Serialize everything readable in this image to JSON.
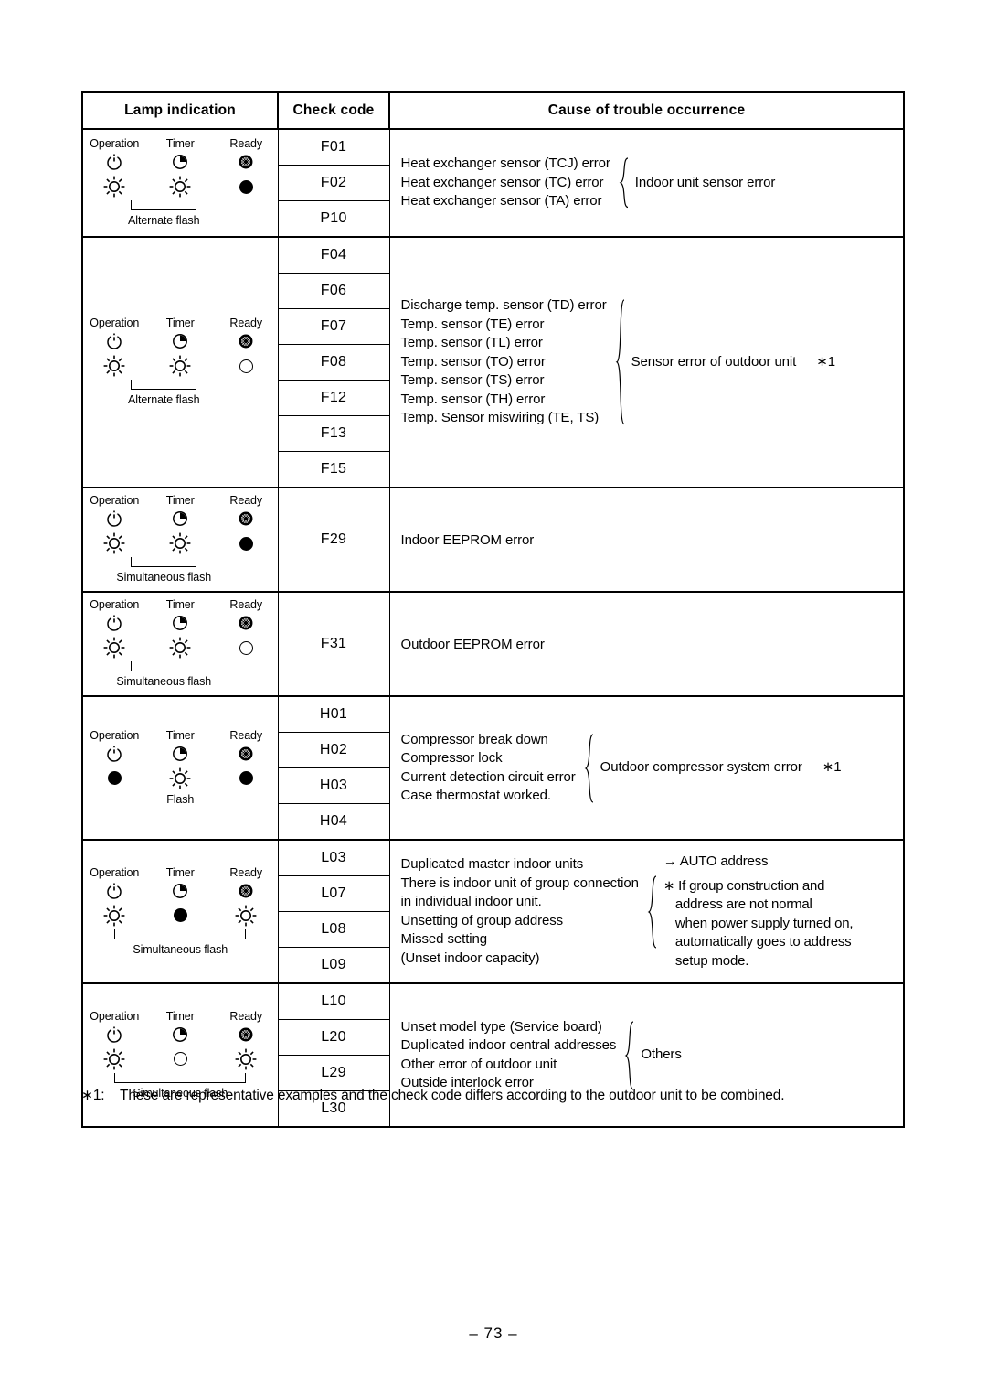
{
  "page": {
    "number": "– 73 –",
    "footnote": {
      "label": "∗1:",
      "text": "These are representative examples and the check code differs according to the outdoor unit to be combined."
    }
  },
  "table": {
    "headers": {
      "lamp": "Lamp indication",
      "code": "Check code",
      "cause": "Cause of trouble occurrence"
    },
    "lamp_labels": {
      "operation": "Operation",
      "timer": "Timer",
      "ready": "Ready"
    },
    "sections": [
      {
        "id": "indoor-sensor",
        "lamp": {
          "operation": "flash",
          "timer": "flash",
          "ready": "on",
          "caption": "Alternate flash",
          "bracket": "two"
        },
        "codes": [
          "F01",
          "F02",
          "P10"
        ],
        "causes": [
          "Heat exchanger sensor (TCJ) error",
          "Heat exchanger sensor (TC) error",
          "Heat exchanger sensor (TA) error"
        ],
        "summary": "Indoor unit sensor error",
        "summary_ref": ""
      },
      {
        "id": "outdoor-sensor",
        "lamp": {
          "operation": "flash",
          "timer": "flash",
          "ready": "off",
          "caption": "Alternate flash",
          "bracket": "two"
        },
        "codes": [
          "F04",
          "F06",
          "F07",
          "F08",
          "F12",
          "F13",
          "F15"
        ],
        "causes": [
          "Discharge temp. sensor (TD) error",
          "Temp. sensor (TE) error",
          "Temp. sensor (TL) error",
          "Temp. sensor (TO) error",
          "Temp. sensor (TS) error",
          "Temp. sensor (TH) error",
          "Temp. Sensor miswiring (TE, TS)"
        ],
        "summary": "Sensor error of outdoor unit",
        "summary_ref": "∗1"
      },
      {
        "id": "indoor-eeprom",
        "lamp": {
          "operation": "flash",
          "timer": "flash",
          "ready": "on",
          "caption": "Simultaneous flash",
          "bracket": "two"
        },
        "codes": [
          "F29"
        ],
        "causes": [
          "Indoor EEPROM error"
        ],
        "summary": "",
        "summary_ref": ""
      },
      {
        "id": "outdoor-eeprom",
        "lamp": {
          "operation": "flash",
          "timer": "flash",
          "ready": "off",
          "caption": "Simultaneous flash",
          "bracket": "two"
        },
        "codes": [
          "F31"
        ],
        "causes": [
          "Outdoor EEPROM error"
        ],
        "summary": "",
        "summary_ref": ""
      },
      {
        "id": "compressor",
        "lamp": {
          "operation": "on",
          "timer": "flash",
          "ready": "on",
          "caption": "Flash",
          "bracket": "none"
        },
        "codes": [
          "H01",
          "H02",
          "H03",
          "H04"
        ],
        "causes": [
          "Compressor break down",
          "Compressor lock",
          "Current detection circuit error",
          "Case thermostat worked."
        ],
        "summary": "Outdoor compressor system error",
        "summary_ref": "∗1"
      },
      {
        "id": "auto-address",
        "lamp": {
          "operation": "flash",
          "timer": "on",
          "ready": "flash",
          "caption": "Simultaneous flash",
          "bracket": "wide"
        },
        "codes": [
          "L03",
          "L07",
          "L08",
          "L09"
        ],
        "causes": [
          "Duplicated master indoor units",
          "There is indoor unit of group connection",
          "in individual indoor unit.",
          "Unsetting of group address",
          "Missed setting",
          "(Unset indoor capacity)"
        ],
        "note": {
          "line1": "→ AUTO address",
          "line2": "∗ If group construction and",
          "line3": "address are not normal",
          "line4": "when power supply turned on,",
          "line5": "automatically goes to address",
          "line6": "setup mode."
        }
      },
      {
        "id": "others",
        "lamp": {
          "operation": "flash",
          "timer": "off",
          "ready": "flash",
          "caption": "Simultaneous flash",
          "bracket": "wide"
        },
        "codes": [
          "L10",
          "L20",
          "L29",
          "L30"
        ],
        "causes": [
          "Unset model type (Service board)",
          "Duplicated indoor central addresses",
          "Other error of outdoor unit",
          "Outside interlock error"
        ],
        "summary": "Others",
        "summary_ref": ""
      }
    ]
  }
}
